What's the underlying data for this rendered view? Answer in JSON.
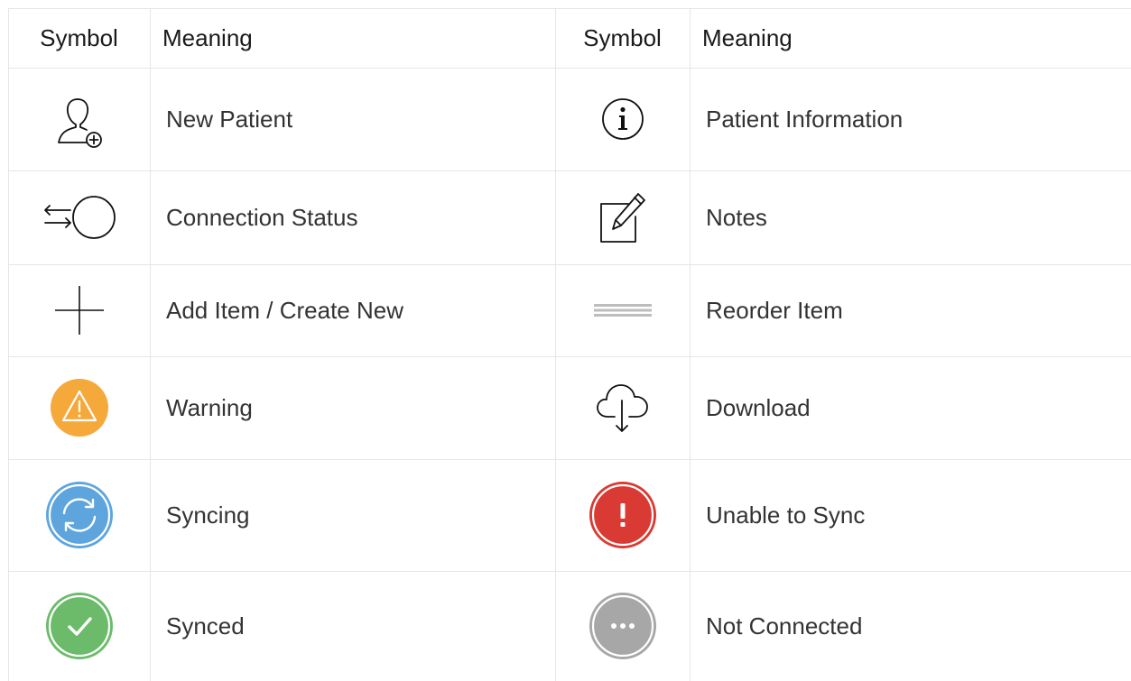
{
  "table": {
    "headers": {
      "left_symbol": "Symbol",
      "left_meaning": "Meaning",
      "right_symbol": "Symbol",
      "right_meaning": "Meaning"
    },
    "rows": [
      {
        "left": {
          "icon": "new-patient-icon",
          "meaning": "New Patient"
        },
        "right": {
          "icon": "info-icon",
          "meaning": "Patient Information"
        }
      },
      {
        "left": {
          "icon": "connection-status-icon",
          "meaning": "Connection Status"
        },
        "right": {
          "icon": "notes-icon",
          "meaning": "Notes"
        }
      },
      {
        "left": {
          "icon": "plus-icon",
          "meaning": "Add Item / Create New"
        },
        "right": {
          "icon": "reorder-icon",
          "meaning": "Reorder Item"
        }
      },
      {
        "left": {
          "icon": "warning-icon",
          "meaning": "Warning"
        },
        "right": {
          "icon": "download-icon",
          "meaning": "Download"
        }
      },
      {
        "left": {
          "icon": "syncing-icon",
          "meaning": "Syncing"
        },
        "right": {
          "icon": "unable-to-sync-icon",
          "meaning": "Unable to Sync"
        }
      },
      {
        "left": {
          "icon": "synced-icon",
          "meaning": "Synced"
        },
        "right": {
          "icon": "not-connected-icon",
          "meaning": "Not Connected"
        }
      }
    ]
  },
  "colors": {
    "warning": "#f5a93b",
    "syncing": "#5ea5de",
    "error": "#d93a33",
    "synced": "#6bbb6b",
    "not_connected": "#a7a7a7",
    "gridline": "#e6e6e6"
  }
}
